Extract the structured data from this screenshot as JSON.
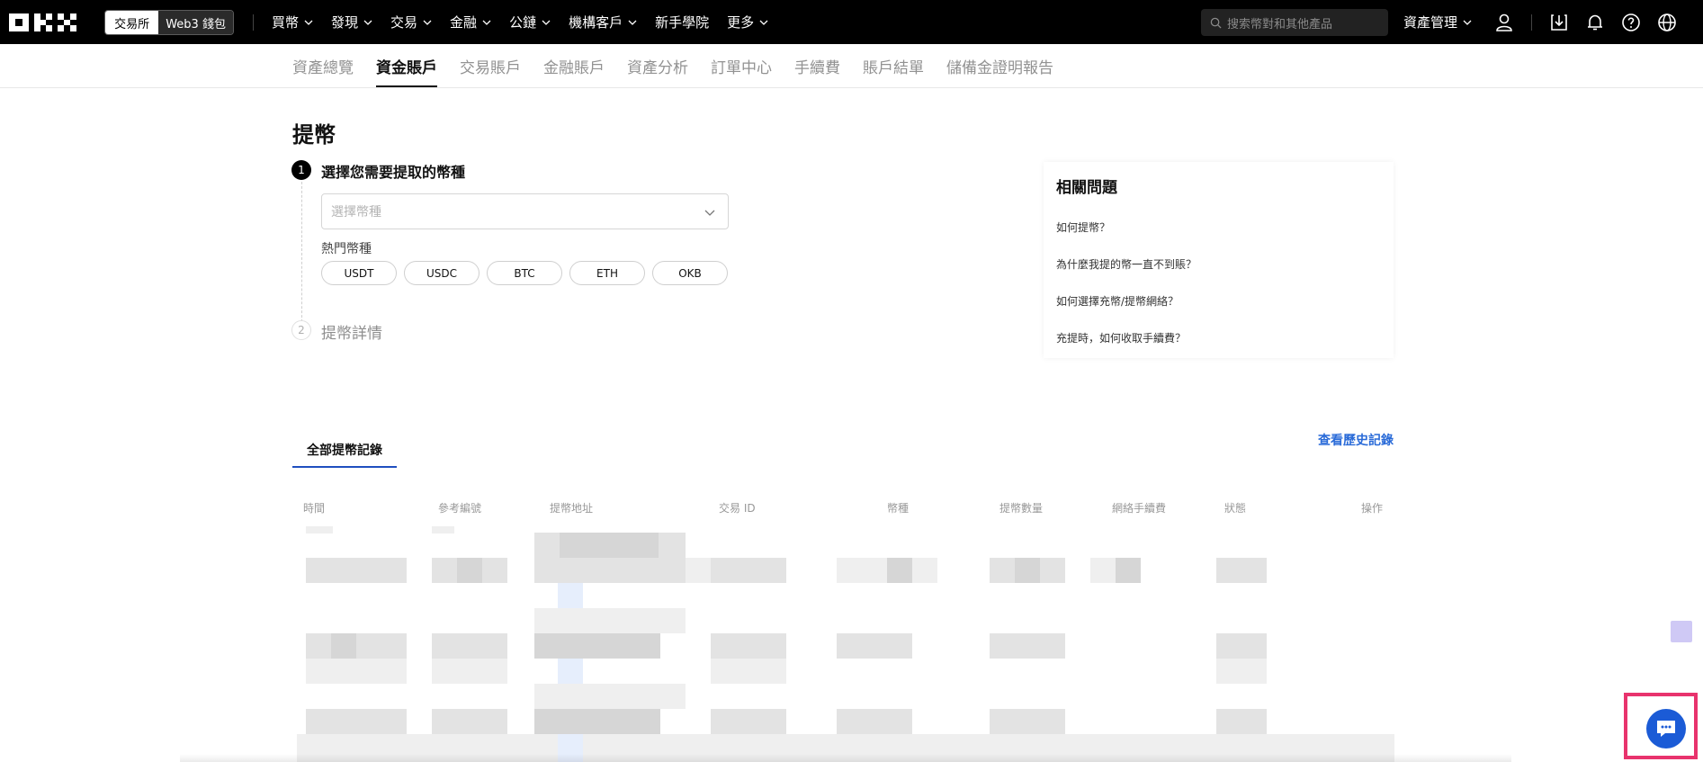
{
  "topnav": {
    "mode_exchange": "交易所",
    "mode_web3": "Web3 錢包",
    "items": [
      "買幣",
      "發現",
      "交易",
      "金融",
      "公鏈",
      "機構客戶",
      "新手學院",
      "更多"
    ],
    "search_placeholder": "搜索幣對和其他產品",
    "asset_management": "資產管理"
  },
  "subnav": {
    "tabs": [
      "資產總覽",
      "資金賬戶",
      "交易賬戶",
      "金融賬戶",
      "資產分析",
      "訂單中心",
      "手續費",
      "賬戶結單",
      "儲備金證明報告"
    ],
    "active_index": 1
  },
  "page": {
    "title": "提幣",
    "step1": {
      "number": "1",
      "title": "選擇您需要提取的幣種"
    },
    "coin_select_placeholder": "選擇幣種",
    "hot_label": "熱門幣種",
    "hot_coins": [
      "USDT",
      "USDC",
      "BTC",
      "ETH",
      "OKB"
    ],
    "step2": {
      "number": "2",
      "title": "提幣詳情"
    }
  },
  "faq": {
    "title": "相關問題",
    "links": [
      "如何提幣？",
      "為什麼我提的幣一直不到賬？",
      "如何選擇充幣/提幣網絡？",
      "充提時，如何收取手續費？"
    ]
  },
  "records": {
    "tab": "全部提幣記錄",
    "history_link": "查看歷史記錄",
    "columns": [
      "時間",
      "參考編號",
      "提幣地址",
      "交易 ID",
      "幣種",
      "提幣數量",
      "網絡手續費",
      "狀態",
      "操作"
    ]
  },
  "colors": {
    "accent": "#2a6bd8",
    "chat_button": "#1b5bd6",
    "highlight_frame": "#e8336d"
  }
}
